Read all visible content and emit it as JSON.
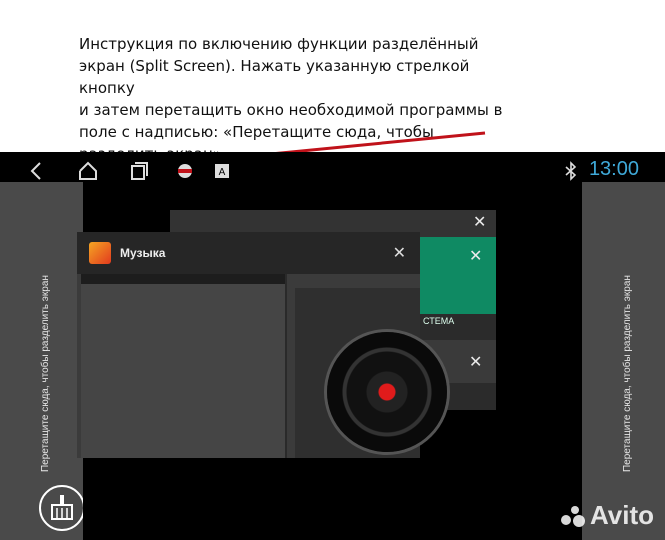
{
  "instruction": {
    "lines": [
      "Инструкция по включению функции разделённый",
      "экран (Split Screen). Нажать указанную стрелкой кнопку",
      "и затем перетащить окно необходимой программы в",
      "поле с надписью: «Перетащите сюда, чтобы",
      "разделить экран»"
    ]
  },
  "statusbar": {
    "time": "13:00",
    "icons": [
      "back-icon",
      "home-icon",
      "recents-icon",
      "app-icon",
      "keyboard-icon",
      "bluetooth-icon"
    ]
  },
  "split": {
    "left_hint": "Перетащите сюда, чтобы разделить экран",
    "right_hint": "Перетащите сюда, чтобы разделить экран"
  },
  "recents": {
    "music_title": "Музыка",
    "system_label": "СТЕМА",
    "close_glyph": "✕"
  },
  "watermark": "Avito",
  "colors": {
    "accent_time": "#3fa9d8",
    "arrow": "#c0121a",
    "green_card": "#0f8a63"
  }
}
